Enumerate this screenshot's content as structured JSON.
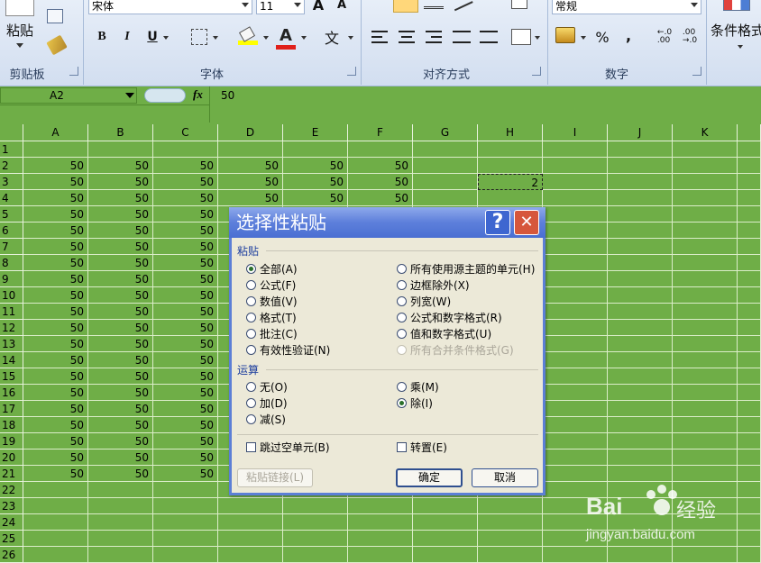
{
  "ribbon": {
    "paste_label": "粘贴",
    "font_name": "宋体",
    "font_size": "11",
    "number_format": "常规",
    "conditional_format_label": "条件格式",
    "groups": {
      "clipboard": "剪贴板",
      "font": "字体",
      "alignment": "对齐方式",
      "number": "数字"
    },
    "bold": "B",
    "italic": "I",
    "underline": "U",
    "font_color_glyph": "A",
    "phonetic_glyph": "wén",
    "percent": "%",
    "comma": ","
  },
  "formula_bar": {
    "name_box": "A2",
    "fx": "fx",
    "value": "50"
  },
  "sheet": {
    "columns": [
      "A",
      "B",
      "C",
      "D",
      "E",
      "F",
      "G",
      "H",
      "I",
      "J",
      "K"
    ],
    "rows": [
      "1",
      "2",
      "3",
      "4",
      "5",
      "6",
      "7",
      "8",
      "9",
      "10",
      "11",
      "12",
      "13",
      "14",
      "15",
      "16",
      "17",
      "18",
      "19",
      "20",
      "21",
      "22",
      "23",
      "24",
      "25",
      "26"
    ],
    "cell_value": "50",
    "h3_value": "2"
  },
  "dialog": {
    "title": "选择性粘贴",
    "help": "?",
    "close": "✕",
    "paste_section": "粘贴",
    "paste_left": [
      "全部(A)",
      "公式(F)",
      "数值(V)",
      "格式(T)",
      "批注(C)",
      "有效性验证(N)"
    ],
    "paste_right": [
      "所有使用源主题的单元(H)",
      "边框除外(X)",
      "列宽(W)",
      "公式和数字格式(R)",
      "值和数字格式(U)",
      "所有合并条件格式(G)"
    ],
    "operation_section": "运算",
    "op_left": [
      "无(O)",
      "加(D)",
      "减(S)"
    ],
    "op_right": [
      "乘(M)",
      "除(I)"
    ],
    "skip_blanks": "跳过空单元(B)",
    "transpose": "转置(E)",
    "paste_link": "粘贴链接(L)",
    "ok": "确定",
    "cancel": "取消"
  },
  "watermark": {
    "brand": "Bai",
    "brand_cn": "经验",
    "url": "jingyan.baidu.com"
  }
}
